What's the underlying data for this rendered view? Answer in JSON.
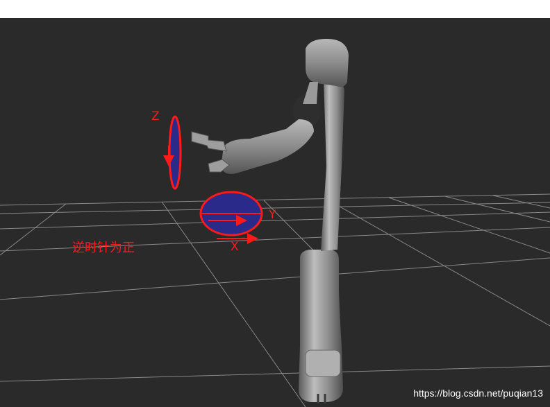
{
  "viewport": {
    "background_color": "#2a2a2a",
    "top_band_color": "#ffffff",
    "grid_color": "#9a9a9a"
  },
  "robot": {
    "body_color": "#8e8e8e",
    "shadow_color": "#4a4a4a",
    "highlight_color": "#c4c4c4"
  },
  "annotations": {
    "z_axis_label": "Z",
    "y_axis_label": "Y",
    "x_axis_label": "X",
    "caption": "逆时针为正",
    "ellipse_stroke": "#ff1a1a",
    "ellipse_fill": "#2a2a8a"
  },
  "watermark": "https://blog.csdn.net/puqian13"
}
